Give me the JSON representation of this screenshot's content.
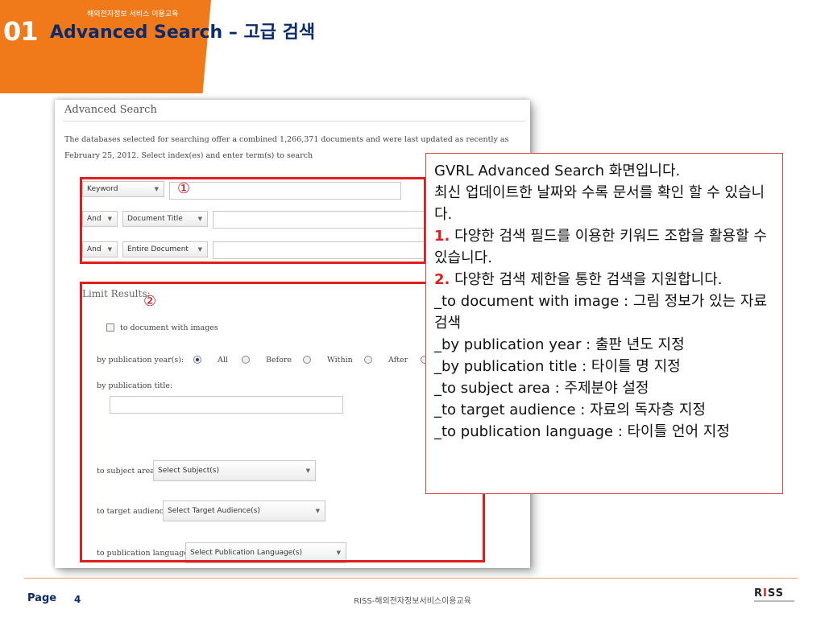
{
  "header": {
    "subtitle": "해외전자정보 서비스 이용교육",
    "section_number": "01",
    "title": "Advanced Search – 고급 검색",
    "accent_color": "#f07a1a"
  },
  "screenshot": {
    "heading": "Advanced Search",
    "description": "The databases selected for searching offer a combined  1,266,371  documents  and were last updated as recently as February 25, 2012. Select index(es) and enter term(s) to search",
    "search_rows": [
      {
        "field": "Keyword"
      },
      {
        "operator": "And",
        "field": "Document Title"
      },
      {
        "operator": "And",
        "field": "Entire Document"
      }
    ],
    "marker1": "①",
    "marker2": "②",
    "limit_title": "Limit Results:",
    "images_label": "to document with images",
    "pubyear_label": "by publication year(s):",
    "pubyear_options": [
      "All",
      "Before",
      "Within",
      "After"
    ],
    "pubyear_selected": "All",
    "pubtitle_label": "by publication title:",
    "subject_label": "to subject area:",
    "subject_select": "Select Subject(s)",
    "audience_label": "to target audience",
    "audience_select": "Select Target Audience(s)",
    "language_label": "to publication language:",
    "language_select": "Select Publication Language(s)"
  },
  "callout": {
    "line1": "GVRL Advanced Search 화면입니다.",
    "line2": "최신 업데이트한 날짜와 수록 문서를 확인 할 수 있습니다.",
    "item1_num": "1.",
    "item1_text": " 다양한 검색 필드를 이용한 키워드 조합을 활용할 수 있습니다.",
    "item2_num": "2.",
    "item2_text": " 다양한 검색 제한을 통한 검색을 지원합니다.",
    "desc1": "_to document with image : 그림 정보가 있는 자료 검색",
    "desc2": "_by publication year : 출판 년도 지정",
    "desc3": "_by publication title : 타이틀 명 지정",
    "desc4": "_to subject area : 주제분야 설정",
    "desc5": "_to target audience : 자료의 독자층 지정",
    "desc6": "_to publication language : 타이틀 언어 지정"
  },
  "footer": {
    "page_label": "Page",
    "page_number": "4",
    "center_text": "RISS-해외전자정보서비스이용교육",
    "logo_r": "R",
    "logo_i": "I",
    "logo_ss": "SS"
  }
}
